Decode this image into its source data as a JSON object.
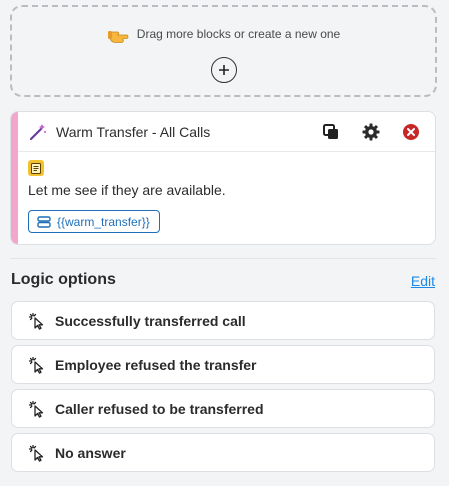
{
  "dropzone": {
    "text": "Drag more blocks or create a new one",
    "hand_icon": "pointing-hand-icon",
    "add_icon": "plus-icon"
  },
  "block": {
    "title": "Warm Transfer - All Calls",
    "title_icon": "magic-wand-icon",
    "accent_color": "#f3a6cc",
    "actions": [
      "copy-icon",
      "gear-icon",
      "close-icon"
    ],
    "note_icon": "note-icon",
    "say_text": "Let me see if they are available.",
    "variable": "{{warm_transfer}}",
    "variable_icon": "database-icon"
  },
  "logic": {
    "title": "Logic options",
    "edit_label": "Edit",
    "options": [
      {
        "label": "Successfully transferred call",
        "icon": "click-pointer-icon"
      },
      {
        "label": "Employee refused the transfer",
        "icon": "click-pointer-icon"
      },
      {
        "label": "Caller refused to be transferred",
        "icon": "click-pointer-icon"
      },
      {
        "label": "No answer",
        "icon": "click-pointer-icon"
      }
    ]
  }
}
